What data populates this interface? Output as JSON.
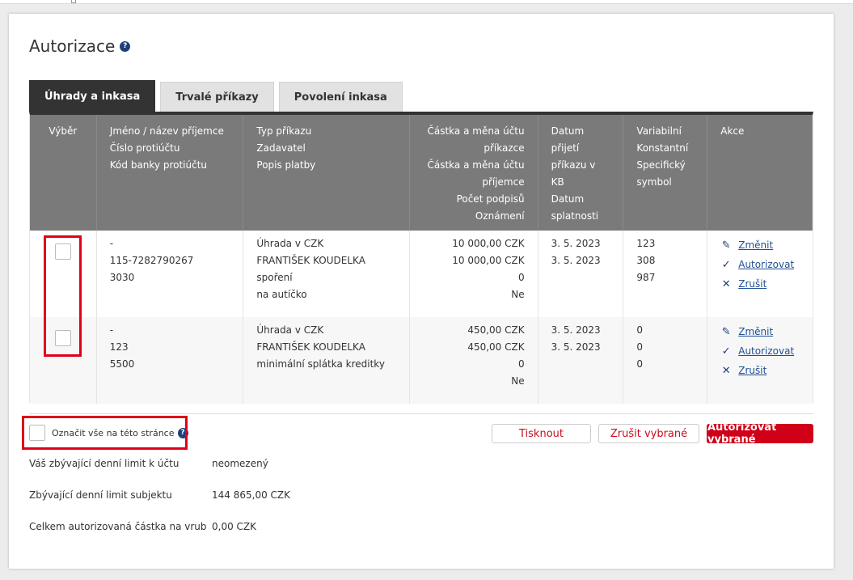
{
  "page": {
    "title": "Autorizace",
    "help_glyph": "?"
  },
  "tabs": [
    {
      "label": "Úhrady a inkasa",
      "active": true
    },
    {
      "label": "Trvalé příkazy",
      "active": false
    },
    {
      "label": "Povolení inkasa",
      "active": false
    }
  ],
  "table": {
    "headers": [
      [
        "Výběr"
      ],
      [
        "Jméno / název příjemce",
        "Číslo protiúčtu",
        "Kód banky protiúčtu"
      ],
      [
        "Typ příkazu",
        "Zadavatel",
        "Popis platby"
      ],
      [
        "Částka a měna účtu",
        "příkazce",
        "Částka a měna účtu",
        "příjemce",
        "Počet podpisů",
        "Oznámení"
      ],
      [
        "Datum",
        "přijetí",
        "příkazu v KB",
        "Datum",
        "splatnosti"
      ],
      [
        "Variabilní",
        "Konstantní",
        "Specifický",
        "symbol"
      ],
      [
        "Akce"
      ]
    ],
    "rows": [
      {
        "recipient": [
          "-",
          "115-7282790267",
          "3030"
        ],
        "type": [
          "Úhrada v CZK",
          "FRANTIŠEK KOUDELKA",
          "spoření",
          "na autíčko"
        ],
        "amount": [
          "10 000,00 CZK",
          "10 000,00 CZK",
          "0",
          "Ne"
        ],
        "dates": [
          "3. 5. 2023",
          "3. 5. 2023"
        ],
        "symbols": [
          "123",
          "308",
          "987"
        ]
      },
      {
        "recipient": [
          "-",
          "123",
          "5500"
        ],
        "type": [
          "Úhrada v CZK",
          "FRANTIŠEK KOUDELKA",
          "minimální splátka kreditky"
        ],
        "amount": [
          "450,00 CZK",
          "450,00 CZK",
          "0",
          "Ne"
        ],
        "dates": [
          "3. 5. 2023",
          "3. 5. 2023"
        ],
        "symbols": [
          "0",
          "0",
          "0"
        ]
      }
    ],
    "actions": [
      {
        "icon": "pencil-icon",
        "glyph": "✎",
        "label": "Změnit"
      },
      {
        "icon": "check-icon",
        "glyph": "✓",
        "label": "Autorizovat"
      },
      {
        "icon": "close-icon",
        "glyph": "✕",
        "label": "Zrušit"
      }
    ]
  },
  "select_all": {
    "label": "Označit vše na této stránce"
  },
  "buttons": {
    "print": "Tisknout",
    "cancel_selected": "Zrušit vybrané",
    "authorize_selected": "Autorizovat vybrané"
  },
  "limits": [
    {
      "label": "Váš zbývající denní limit k účtu",
      "value": "neomezený"
    },
    {
      "label": "Zbývající denní limit subjektu",
      "value": "144 865,00 CZK"
    },
    {
      "label": "Celkem autorizovaná částka na vrub",
      "value": "0,00 CZK"
    }
  ],
  "colors": {
    "accent_red": "#d00018",
    "link_blue": "#1e4f96",
    "header_gray": "#7a7a7a",
    "tab_active": "#333333"
  }
}
